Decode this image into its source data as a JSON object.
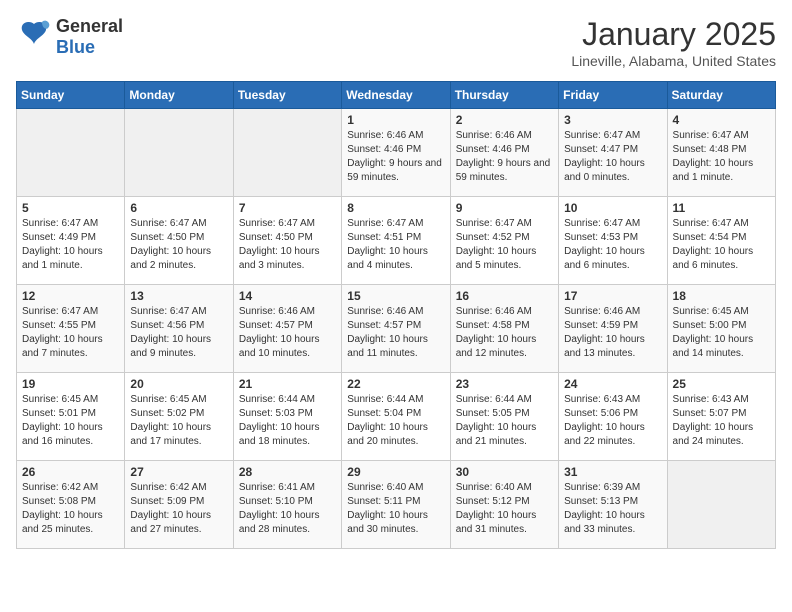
{
  "header": {
    "logo_general": "General",
    "logo_blue": "Blue",
    "title": "January 2025",
    "location": "Lineville, Alabama, United States"
  },
  "days_of_week": [
    "Sunday",
    "Monday",
    "Tuesday",
    "Wednesday",
    "Thursday",
    "Friday",
    "Saturday"
  ],
  "weeks": [
    [
      {
        "day": "",
        "info": ""
      },
      {
        "day": "",
        "info": ""
      },
      {
        "day": "",
        "info": ""
      },
      {
        "day": "1",
        "info": "Sunrise: 6:46 AM\nSunset: 4:46 PM\nDaylight: 9 hours and 59 minutes."
      },
      {
        "day": "2",
        "info": "Sunrise: 6:46 AM\nSunset: 4:46 PM\nDaylight: 9 hours and 59 minutes."
      },
      {
        "day": "3",
        "info": "Sunrise: 6:47 AM\nSunset: 4:47 PM\nDaylight: 10 hours and 0 minutes."
      },
      {
        "day": "4",
        "info": "Sunrise: 6:47 AM\nSunset: 4:48 PM\nDaylight: 10 hours and 1 minute."
      }
    ],
    [
      {
        "day": "5",
        "info": "Sunrise: 6:47 AM\nSunset: 4:49 PM\nDaylight: 10 hours and 1 minute."
      },
      {
        "day": "6",
        "info": "Sunrise: 6:47 AM\nSunset: 4:50 PM\nDaylight: 10 hours and 2 minutes."
      },
      {
        "day": "7",
        "info": "Sunrise: 6:47 AM\nSunset: 4:50 PM\nDaylight: 10 hours and 3 minutes."
      },
      {
        "day": "8",
        "info": "Sunrise: 6:47 AM\nSunset: 4:51 PM\nDaylight: 10 hours and 4 minutes."
      },
      {
        "day": "9",
        "info": "Sunrise: 6:47 AM\nSunset: 4:52 PM\nDaylight: 10 hours and 5 minutes."
      },
      {
        "day": "10",
        "info": "Sunrise: 6:47 AM\nSunset: 4:53 PM\nDaylight: 10 hours and 6 minutes."
      },
      {
        "day": "11",
        "info": "Sunrise: 6:47 AM\nSunset: 4:54 PM\nDaylight: 10 hours and 6 minutes."
      }
    ],
    [
      {
        "day": "12",
        "info": "Sunrise: 6:47 AM\nSunset: 4:55 PM\nDaylight: 10 hours and 7 minutes."
      },
      {
        "day": "13",
        "info": "Sunrise: 6:47 AM\nSunset: 4:56 PM\nDaylight: 10 hours and 9 minutes."
      },
      {
        "day": "14",
        "info": "Sunrise: 6:46 AM\nSunset: 4:57 PM\nDaylight: 10 hours and 10 minutes."
      },
      {
        "day": "15",
        "info": "Sunrise: 6:46 AM\nSunset: 4:57 PM\nDaylight: 10 hours and 11 minutes."
      },
      {
        "day": "16",
        "info": "Sunrise: 6:46 AM\nSunset: 4:58 PM\nDaylight: 10 hours and 12 minutes."
      },
      {
        "day": "17",
        "info": "Sunrise: 6:46 AM\nSunset: 4:59 PM\nDaylight: 10 hours and 13 minutes."
      },
      {
        "day": "18",
        "info": "Sunrise: 6:45 AM\nSunset: 5:00 PM\nDaylight: 10 hours and 14 minutes."
      }
    ],
    [
      {
        "day": "19",
        "info": "Sunrise: 6:45 AM\nSunset: 5:01 PM\nDaylight: 10 hours and 16 minutes."
      },
      {
        "day": "20",
        "info": "Sunrise: 6:45 AM\nSunset: 5:02 PM\nDaylight: 10 hours and 17 minutes."
      },
      {
        "day": "21",
        "info": "Sunrise: 6:44 AM\nSunset: 5:03 PM\nDaylight: 10 hours and 18 minutes."
      },
      {
        "day": "22",
        "info": "Sunrise: 6:44 AM\nSunset: 5:04 PM\nDaylight: 10 hours and 20 minutes."
      },
      {
        "day": "23",
        "info": "Sunrise: 6:44 AM\nSunset: 5:05 PM\nDaylight: 10 hours and 21 minutes."
      },
      {
        "day": "24",
        "info": "Sunrise: 6:43 AM\nSunset: 5:06 PM\nDaylight: 10 hours and 22 minutes."
      },
      {
        "day": "25",
        "info": "Sunrise: 6:43 AM\nSunset: 5:07 PM\nDaylight: 10 hours and 24 minutes."
      }
    ],
    [
      {
        "day": "26",
        "info": "Sunrise: 6:42 AM\nSunset: 5:08 PM\nDaylight: 10 hours and 25 minutes."
      },
      {
        "day": "27",
        "info": "Sunrise: 6:42 AM\nSunset: 5:09 PM\nDaylight: 10 hours and 27 minutes."
      },
      {
        "day": "28",
        "info": "Sunrise: 6:41 AM\nSunset: 5:10 PM\nDaylight: 10 hours and 28 minutes."
      },
      {
        "day": "29",
        "info": "Sunrise: 6:40 AM\nSunset: 5:11 PM\nDaylight: 10 hours and 30 minutes."
      },
      {
        "day": "30",
        "info": "Sunrise: 6:40 AM\nSunset: 5:12 PM\nDaylight: 10 hours and 31 minutes."
      },
      {
        "day": "31",
        "info": "Sunrise: 6:39 AM\nSunset: 5:13 PM\nDaylight: 10 hours and 33 minutes."
      },
      {
        "day": "",
        "info": ""
      }
    ]
  ]
}
